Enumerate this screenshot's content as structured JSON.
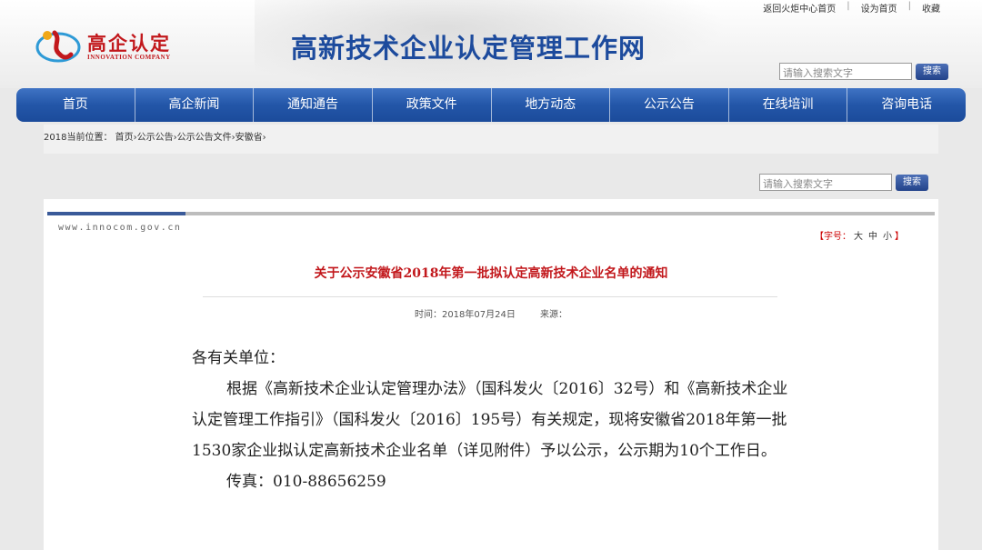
{
  "top_links": [
    "返回火炬中心首页",
    "设为首页",
    "收藏"
  ],
  "logo": {
    "cn": "高企认定",
    "en": "INNOVATION COMPANY"
  },
  "site_title": "高新技术企业认定管理工作网",
  "search": {
    "placeholder": "请输入搜索文字",
    "button": "搜索"
  },
  "nav": [
    "首页",
    "高企新闻",
    "通知通告",
    "政策文件",
    "地方动态",
    "公示公告",
    "在线培训",
    "咨询电话"
  ],
  "breadcrumb": {
    "prefix": "2018当前位置：",
    "items": [
      "首页",
      "公示公告",
      "公示公告文件",
      "安徽省"
    ]
  },
  "article": {
    "domain": "www.innocom.gov.cn",
    "font_size_label": "【字号：",
    "font_sizes": [
      "大",
      "中",
      "小"
    ],
    "font_size_end": "】",
    "title": "关于公示安徽省2018年第一批拟认定高新技术企业名单的通知",
    "time": "时间：2018年07月24日",
    "source": "来源：",
    "greeting": "各有关单位：",
    "paragraph": "根据《高新技术企业认定管理办法》（国科发火〔2016〕32号）和《高新技术企业认定管理工作指引》（国科发火〔2016〕195号）有关规定，现将安徽省2018年第一批1530家企业拟认定高新技术企业名单（详见附件）予以公示，公示期为10个工作日。",
    "fax": "传真：010-88656259"
  },
  "colors": {
    "nav": "#2356a8",
    "title_red": "#c2181c",
    "site_title_blue": "#1d4b9d"
  }
}
